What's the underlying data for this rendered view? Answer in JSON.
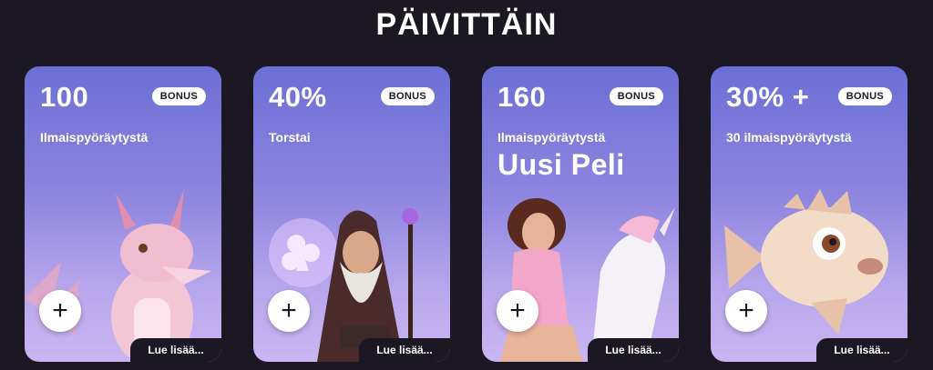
{
  "section": {
    "title": "PÄIVITTÄIN"
  },
  "cards": [
    {
      "value": "100",
      "badge": "BONUS",
      "subtitle": "Ilmaispyöräytystä",
      "headline": "",
      "add_label": "+",
      "read_more": "Lue lisää...",
      "illustration": "pink-dragon-icon"
    },
    {
      "value": "40%",
      "badge": "BONUS",
      "subtitle": "Torstai",
      "headline": "",
      "add_label": "+",
      "read_more": "Lue lisää...",
      "illustration": "wizard-icon"
    },
    {
      "value": "160",
      "badge": "BONUS",
      "subtitle": "Ilmaispyöräytystä",
      "headline": "Uusi Peli",
      "add_label": "+",
      "read_more": "Lue lisää...",
      "illustration": "rider-with-unicorn-icon"
    },
    {
      "value": "30% +",
      "badge": "BONUS",
      "subtitle": "30 ilmaispyöräytystä",
      "headline": "",
      "add_label": "+",
      "read_more": "Lue lisää...",
      "illustration": "pufferfish-icon"
    }
  ],
  "colors": {
    "background": "#1c1823",
    "card_top": "#6b6fd6",
    "card_bottom": "#c9b6f2",
    "badge_bg": "#ffffff"
  }
}
